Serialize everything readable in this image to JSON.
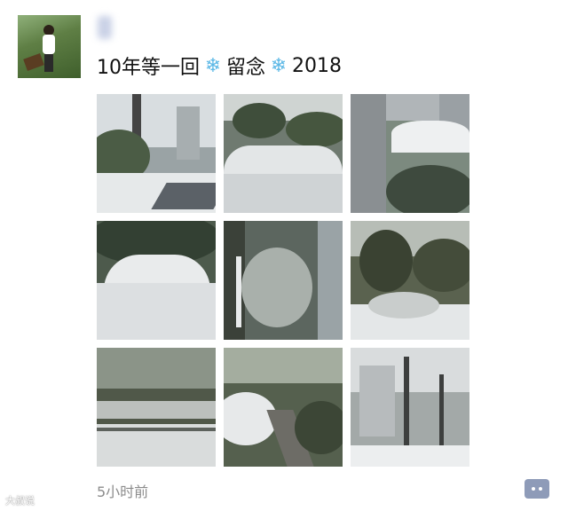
{
  "post": {
    "avatar_alt": "",
    "username": "",
    "text_prefix": "10年等一回",
    "text_middle": "留念",
    "text_suffix": "2018",
    "decor_icon": "snowflake-icon",
    "time": "5小时前",
    "comment_icon": "comment-dots-icon"
  },
  "photos": [
    {
      "subject": "snowy street with apartment towers"
    },
    {
      "subject": "snow-covered car hood"
    },
    {
      "subject": "high-rise view of snowy courtyard"
    },
    {
      "subject": "car covered in snow"
    },
    {
      "subject": "snowy hedge path between buildings"
    },
    {
      "subject": "snowy trees and bushes"
    },
    {
      "subject": "snowy garden with steps"
    },
    {
      "subject": "snowy walkway through park"
    },
    {
      "subject": "snow-covered street trees and buildings"
    }
  ],
  "watermark": "大叔说"
}
